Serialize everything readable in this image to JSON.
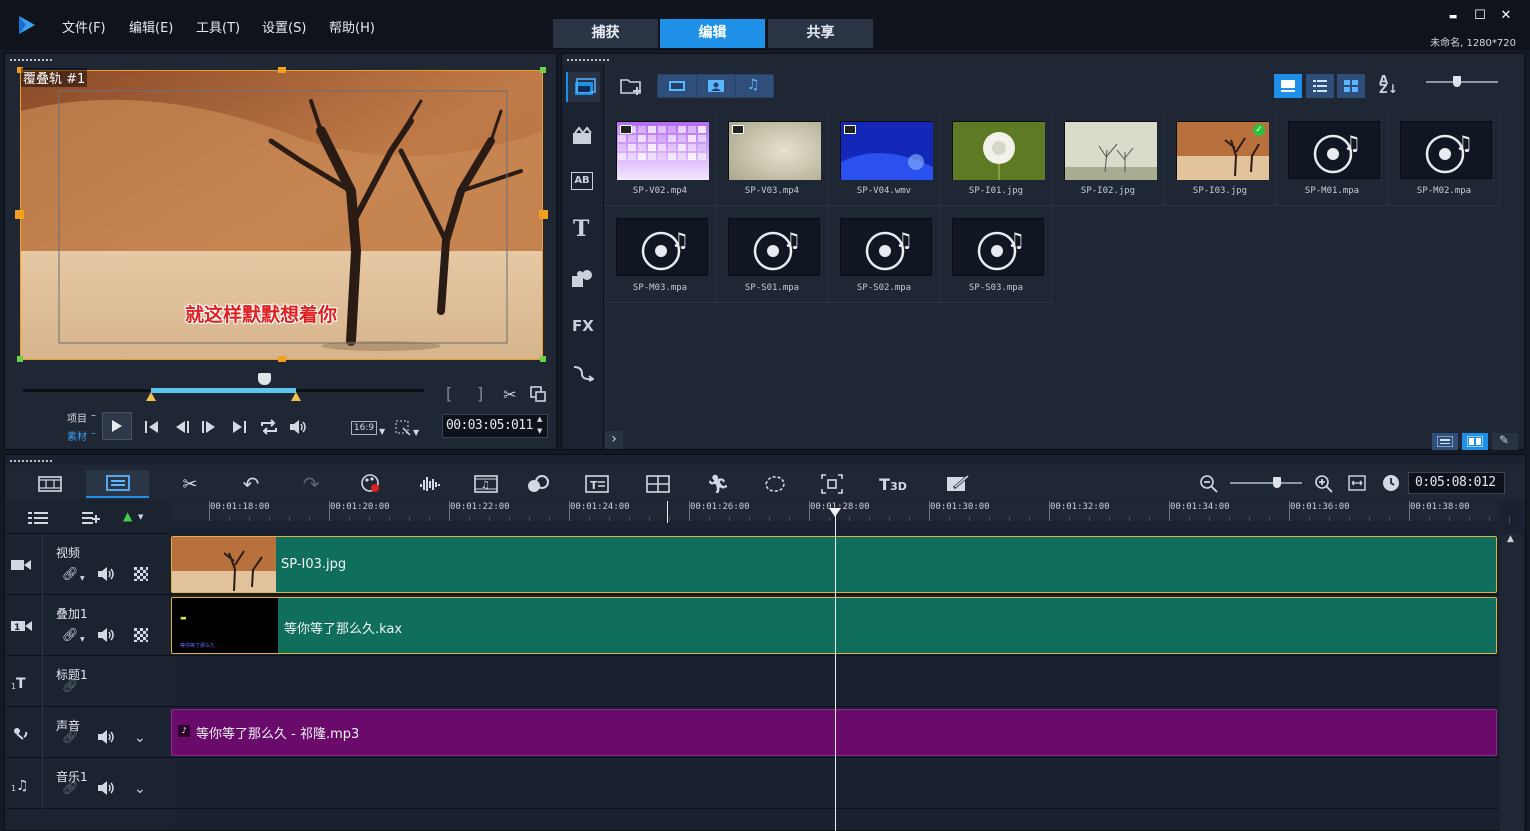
{
  "menu": [
    "文件(F)",
    "编辑(E)",
    "工具(T)",
    "设置(S)",
    "帮助(H)"
  ],
  "tabs": [
    {
      "label": "捕获",
      "active": false
    },
    {
      "label": "编辑",
      "active": true
    },
    {
      "label": "共享",
      "active": false
    }
  ],
  "window_buttons": {
    "minimize": "▬",
    "maximize": "☐",
    "close": "✕"
  },
  "project_info": "未命名, 1280*720",
  "preview": {
    "track_label": "覆叠轨 #1",
    "subtitle": "就这样默默想着你",
    "mode_project": "项目",
    "mode_clip": "素材",
    "aspect": "16:9",
    "timecode": "00:03:05:011",
    "scrub_progress": 0.6,
    "trim_start": 0.32,
    "trim_end": 0.68
  },
  "library": {
    "items": [
      {
        "name": "SP-V02.mp4",
        "kind": "video",
        "thumb": "purple-tiles"
      },
      {
        "name": "SP-V03.mp4",
        "kind": "video",
        "thumb": "beige-gradient"
      },
      {
        "name": "SP-V04.wmv",
        "kind": "video",
        "thumb": "blue-abstract"
      },
      {
        "name": "SP-I01.jpg",
        "kind": "image",
        "thumb": "dandelion"
      },
      {
        "name": "SP-I02.jpg",
        "kind": "image",
        "thumb": "misty-trees"
      },
      {
        "name": "SP-I03.jpg",
        "kind": "image",
        "thumb": "desert-tree",
        "checked": true
      },
      {
        "name": "SP-M01.mpa",
        "kind": "audio"
      },
      {
        "name": "SP-M02.mpa",
        "kind": "audio"
      },
      {
        "name": "SP-M03.mpa",
        "kind": "audio"
      },
      {
        "name": "SP-S01.mpa",
        "kind": "audio"
      },
      {
        "name": "SP-S02.mpa",
        "kind": "audio"
      },
      {
        "name": "SP-S03.mpa",
        "kind": "audio"
      }
    ],
    "side_icons": [
      "media-icon",
      "instant-project-icon",
      "transition-icon",
      "title-icon",
      "graphic-icon",
      "filter-icon",
      "path-icon"
    ],
    "fx_label": "FX"
  },
  "timeline": {
    "total_time": "0:05:08:012",
    "ticks": [
      "00:01:18:00",
      "00:01:20:00",
      "00:01:22:00",
      "00:01:24:00",
      "00:01:26:00",
      "00:01:28:00",
      "00:01:30:00",
      "00:01:32:00",
      "00:01:34:00",
      "00:01:36:00",
      "00:01:38:00"
    ],
    "tracks": [
      {
        "name": "视频",
        "clip": "SP-I03.jpg",
        "color": "#0f6e5c"
      },
      {
        "name": "叠加1",
        "clip": "等你等了那么久.kax",
        "color": "#0f6e5c"
      },
      {
        "name": "标题1",
        "clip": ""
      },
      {
        "name": "声音",
        "clip": "等你等了那么久 - 祁隆.mp3",
        "color": "#6a0a6a"
      },
      {
        "name": "音乐1",
        "clip": ""
      }
    ],
    "overlay_thumb_caption": "等你等了那么久"
  },
  "colors": {
    "accent": "#1e90e8",
    "video_clip": "#0f6e5c",
    "audio_clip": "#6a0a6a",
    "selection": "#f0a020"
  }
}
